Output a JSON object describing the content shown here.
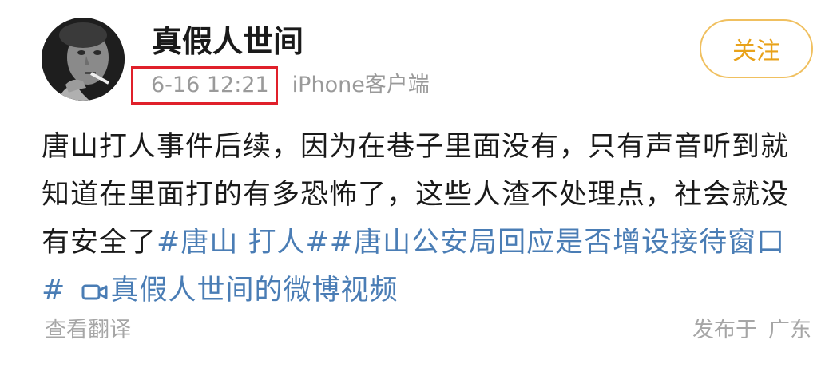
{
  "post": {
    "username": "真假人世间",
    "timestamp": "6-16 12:21",
    "source": "iPhone客户端",
    "follow_label": "关注",
    "body_text": "唐山打人事件后续，因为在巷子里面没有，只有声音听到就知道在里面打的有多恐怖了，这些人渣不处理点，社会就没有安全了",
    "hashtags": [
      "#唐山 打人#",
      "#唐山公安局回应是否增设接待窗口#"
    ],
    "video_link": "真假人世间的微博视频",
    "translate_label": "查看翻译",
    "published_label": "发布于",
    "location": "广东"
  },
  "colors": {
    "link": "#4a7db5",
    "follow": "#e8a21a",
    "highlight_box": "#e0202a",
    "meta_text": "#9a9a9a"
  },
  "icons": [
    "avatar-photo",
    "video-camera-icon"
  ]
}
